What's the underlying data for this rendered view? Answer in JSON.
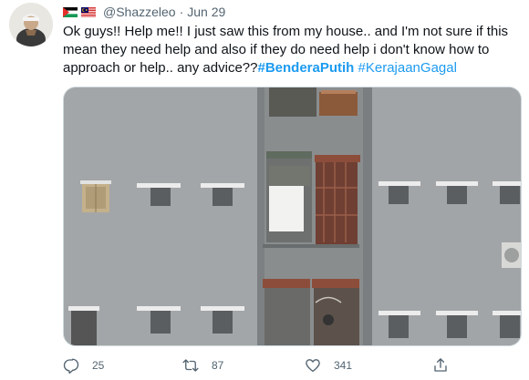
{
  "tweet": {
    "handle": "@Shazzeleo",
    "separator": "·",
    "date": "Jun 29",
    "text_main": "Ok guys!! Help me!! I just saw this from my house.. and I'm not sure if this mean they need help and also if they do need help i don't know how to approach or help.. any advice??",
    "hashtag1": "#BenderaPutih",
    "hashtag2": "#KerajaanGagal"
  },
  "actions": {
    "replies": "25",
    "retweets": "87",
    "likes": "341"
  },
  "icons": {
    "reply": "reply-icon",
    "retweet": "retweet-icon",
    "like": "heart-icon",
    "share": "share-icon"
  },
  "colors": {
    "link": "#1d9bf0",
    "meta": "#536471",
    "text": "#0f1419"
  }
}
